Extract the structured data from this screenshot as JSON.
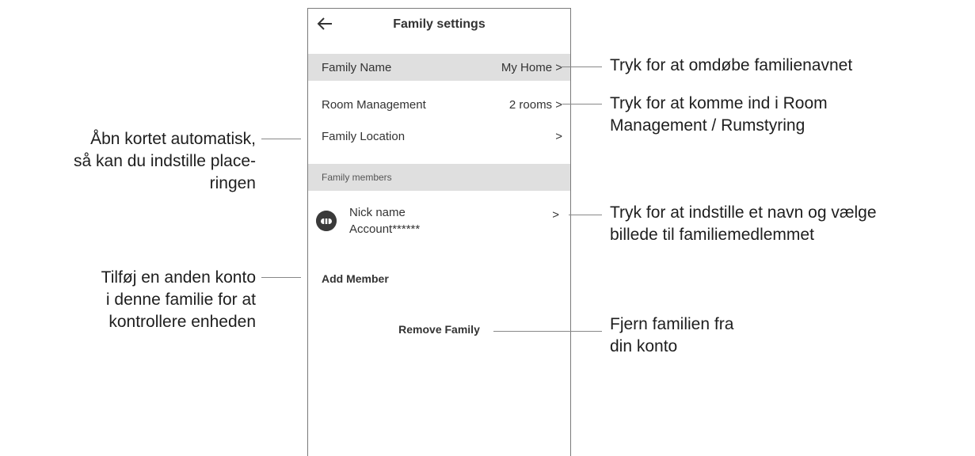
{
  "screen": {
    "title": "Family settings",
    "back_icon": "back-arrow-icon",
    "family_name": {
      "label": "Family Name",
      "value": "My Home >"
    },
    "room_management": {
      "label": "Room Management",
      "value": "2 rooms >"
    },
    "family_location": {
      "label": "Family Location",
      "value": ">"
    },
    "members_section": "Family members",
    "member": {
      "avatar_icon": "user-avatar-icon",
      "nick_name": "Nick name",
      "account": "Account******",
      "chevron": ">"
    },
    "add_member": "Add Member",
    "remove_family": "Remove Family"
  },
  "annotations": {
    "family_name": "Tryk for at omdøbe familienavnet",
    "room_management": [
      "Tryk for at komme ind i Room",
      "Management / Rumstyring"
    ],
    "location": [
      "Åbn kortet automatisk,",
      "så kan du indstille place-",
      "ringen"
    ],
    "member": [
      "Tryk for at indstille et navn og vælge",
      "billede til familiemedlemmet"
    ],
    "add_member": [
      "Tilføj en anden konto",
      "i denne familie for at",
      "kontrollere enheden"
    ],
    "remove_family": [
      "Fjern familien fra",
      "din konto"
    ]
  }
}
